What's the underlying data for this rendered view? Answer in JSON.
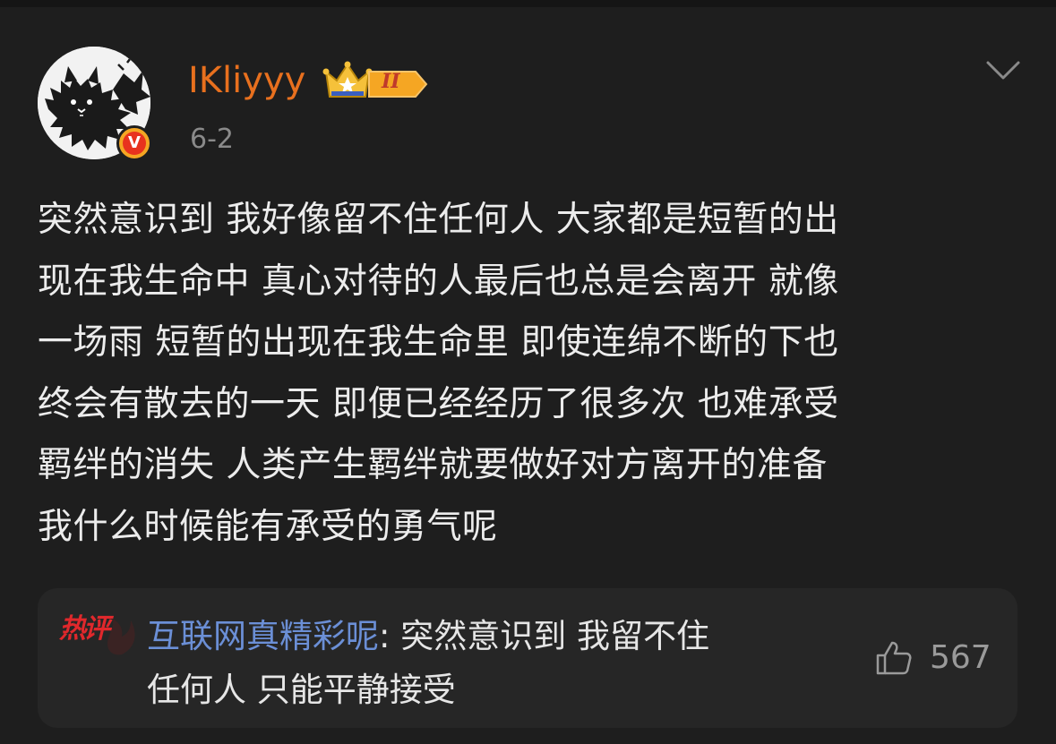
{
  "post": {
    "username": "IKliyyy",
    "level_badge": "II",
    "verified_mark": "V",
    "date": "6-2",
    "body_lines": [
      "突然意识到 我好像留不住任何人 大家都是短暂的出",
      "现在我生命中 真心对待的人最后也总是会离开 就像",
      "一场雨 短暂的出现在我生命里 即使连绵不断的下也",
      "终会有散去的一天 即便已经经历了很多次 也难承受",
      "羁绊的消失 人类产生羁绊就要做好对方离开的准备",
      "我什么时候能有承受的勇气呢"
    ]
  },
  "hot_comment": {
    "tag": "热评",
    "author": "互联网真精彩呢",
    "separator": ": ",
    "text_line1": "突然意识到 我留不住",
    "text_line2": "任何人 只能平静接受",
    "likes": "567"
  },
  "icons": {
    "avatar": "black-cat-avatar",
    "verified": "verified-badge-icon",
    "crown": "crown-level-icon",
    "menu": "chevron-down-icon",
    "like": "thumbs-up-icon"
  },
  "colors": {
    "background": "#1e1e1e",
    "username": "#e8701e",
    "comment_author": "#6b8fd6",
    "hot_tag": "#e0282c",
    "verified": "#f5a623"
  }
}
